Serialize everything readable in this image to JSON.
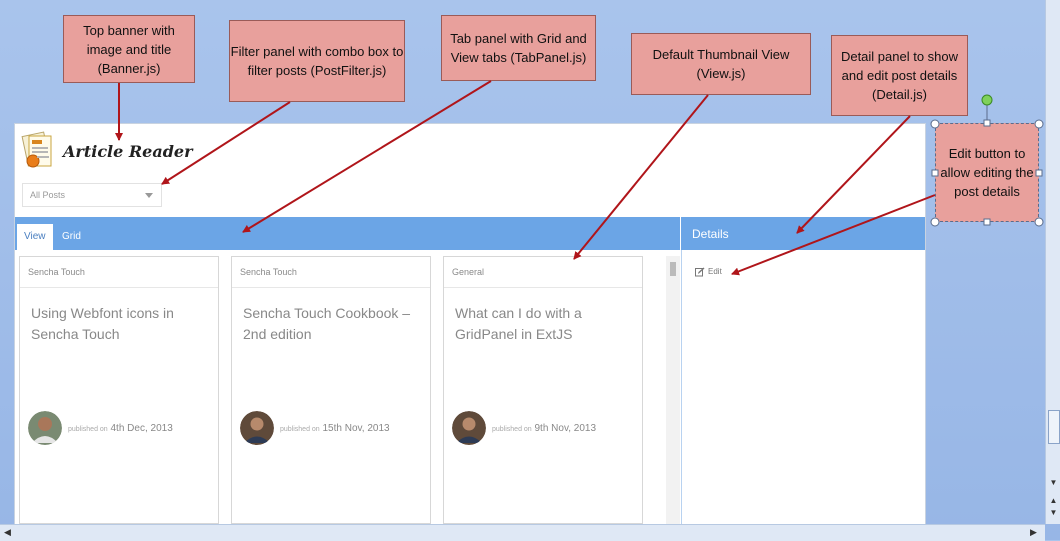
{
  "banner": {
    "app_title": "Article Reader"
  },
  "filter": {
    "value": "All Posts"
  },
  "tabs": [
    {
      "label": "View",
      "active": true
    },
    {
      "label": "Grid",
      "active": false
    }
  ],
  "details": {
    "title": "Details",
    "edit_label": "Edit"
  },
  "posts": [
    {
      "category": "Sencha Touch",
      "title": "Using Webfont icons in Sencha Touch",
      "published_prefix": "published on",
      "date": "4th Dec, 2013"
    },
    {
      "category": "Sencha Touch",
      "title": "Sencha Touch Cookbook – 2nd edition",
      "published_prefix": "published on",
      "date": "15th Nov, 2013"
    },
    {
      "category": "General",
      "title": "What can I do with a GridPanel in ExtJS",
      "published_prefix": "published on",
      "date": "9th Nov, 2013"
    }
  ],
  "annotations": {
    "banner": "Top banner with image and title (Banner.js)",
    "filter": "Filter panel with combo box to filter posts (PostFilter.js)",
    "tabpanel": "Tab panel with Grid and View tabs (TabPanel.js)",
    "view": "Default Thumbnail View (View.js)",
    "detail": "Detail panel to show and edit post details (Detail.js)",
    "edit": "Edit button to allow editing the post details"
  },
  "colors": {
    "accent": "#6ba5e6",
    "callout_fill": "#e8a09c",
    "arrow": "#b0151a",
    "background": "#a9c4ec"
  }
}
